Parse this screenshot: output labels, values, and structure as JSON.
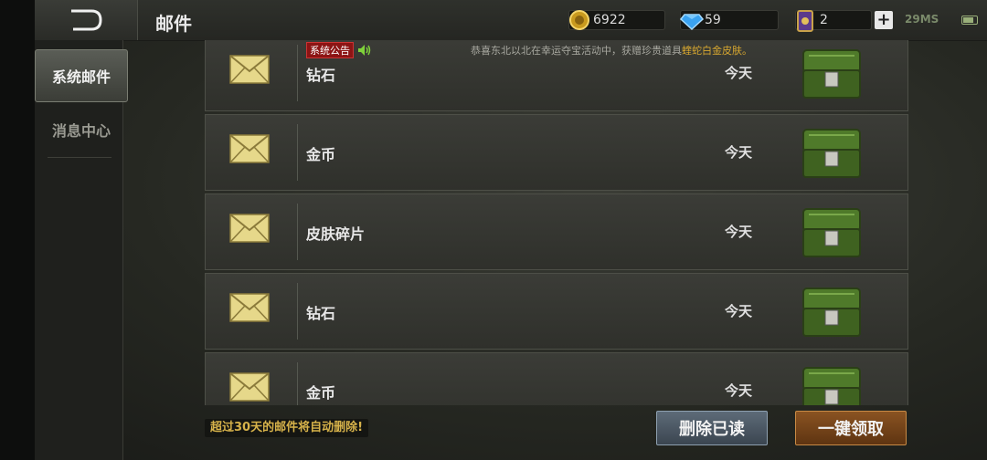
{
  "header": {
    "title": "邮件",
    "gold": "6922",
    "diamond": "59",
    "cards": "2",
    "plus": "+",
    "ping": "29MS"
  },
  "sidebar": {
    "tabs": [
      {
        "label": "系统邮件",
        "active": true
      },
      {
        "label": "消息中心",
        "active": false
      }
    ]
  },
  "announcement": {
    "tag": "系统公告",
    "text": "恭喜东北以北在幸运夺宝活动中，获赠珍贵道具",
    "highlight": "蝰蛇白金皮肤。"
  },
  "mails": [
    {
      "subject": "钻石",
      "date": "今天"
    },
    {
      "subject": "金币",
      "date": "今天"
    },
    {
      "subject": "皮肤碎片",
      "date": "今天"
    },
    {
      "subject": "钻石",
      "date": "今天"
    },
    {
      "subject": "金币",
      "date": "今天"
    }
  ],
  "footer": {
    "notice": "超过30天的邮件将自动删除!",
    "delete_label": "删除已读",
    "claim_label": "一键领取"
  },
  "colors": {
    "accent_gold": "#d6b24a",
    "claim_button": "#8a5322",
    "delete_button": "#5d6b78",
    "announce_tag": "#8c1414"
  }
}
